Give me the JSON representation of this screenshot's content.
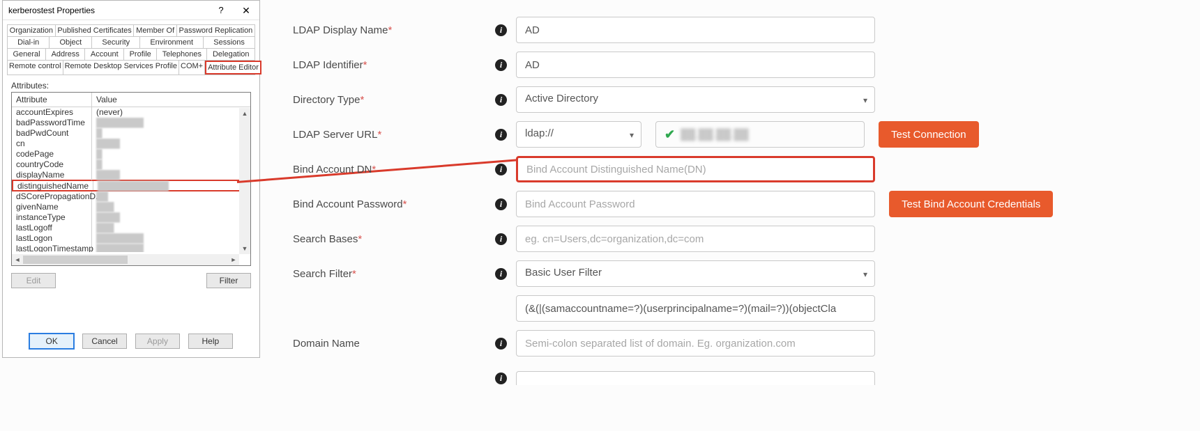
{
  "dialog": {
    "title": "kerberostest Properties",
    "tabs": {
      "row1": [
        "Organization",
        "Published Certificates",
        "Member Of",
        "Password Replication"
      ],
      "row2": [
        "Dial-in",
        "Object",
        "Security",
        "Environment",
        "Sessions"
      ],
      "row3": [
        "General",
        "Address",
        "Account",
        "Profile",
        "Telephones",
        "Delegation"
      ],
      "row4": [
        "Remote control",
        "Remote Desktop Services Profile",
        "COM+",
        "Attribute Editor"
      ]
    },
    "attributes_label": "Attributes:",
    "col_attribute": "Attribute",
    "col_value": "Value",
    "rows": [
      {
        "attr": "accountExpires",
        "val": "(never)",
        "blur": false
      },
      {
        "attr": "badPasswordTime",
        "val": "████████",
        "blur": true
      },
      {
        "attr": "badPwdCount",
        "val": "█",
        "blur": true
      },
      {
        "attr": "cn",
        "val": "████",
        "blur": true
      },
      {
        "attr": "codePage",
        "val": "█",
        "blur": true
      },
      {
        "attr": "countryCode",
        "val": "█",
        "blur": true
      },
      {
        "attr": "displayName",
        "val": "████",
        "blur": true
      },
      {
        "attr": "distinguishedName",
        "val": "████████████",
        "blur": true,
        "highlight": true
      },
      {
        "attr": "dSCorePropagationD...",
        "val": "██",
        "blur": true
      },
      {
        "attr": "givenName",
        "val": "███",
        "blur": true
      },
      {
        "attr": "instanceType",
        "val": "████",
        "blur": true
      },
      {
        "attr": "lastLogoff",
        "val": "███",
        "blur": true
      },
      {
        "attr": "lastLogon",
        "val": "████████",
        "blur": true
      },
      {
        "attr": "lastLogonTimestamp",
        "val": "████████",
        "blur": true
      }
    ],
    "btn_edit": "Edit",
    "btn_filter": "Filter",
    "btn_ok": "OK",
    "btn_cancel": "Cancel",
    "btn_apply": "Apply",
    "btn_help": "Help"
  },
  "form": {
    "labels": {
      "display_name": "LDAP Display Name",
      "identifier": "LDAP Identifier",
      "directory_type": "Directory Type",
      "server_url": "LDAP Server URL",
      "bind_dn": "Bind Account DN",
      "bind_pw": "Bind Account Password",
      "search_bases": "Search Bases",
      "search_filter": "Search Filter",
      "domain_name": "Domain Name"
    },
    "required_mark": "*",
    "values": {
      "display_name": "AD",
      "identifier": "AD",
      "directory_type": "Active Directory",
      "url_scheme": "ldap://",
      "url_verified": "██.██.██.██",
      "search_filter": "Basic User Filter",
      "filter_expr": "(&(|(samaccountname=?)(userprincipalname=?)(mail=?))(objectCla"
    },
    "placeholders": {
      "bind_dn": "Bind Account Distinguished Name(DN)",
      "bind_pw": "Bind Account Password",
      "search_bases": "eg. cn=Users,dc=organization,dc=com",
      "domain_name": "Semi-colon separated list of domain. Eg. organization.com"
    },
    "buttons": {
      "test_connection": "Test Connection",
      "test_bind": "Test Bind Account Credentials"
    }
  }
}
